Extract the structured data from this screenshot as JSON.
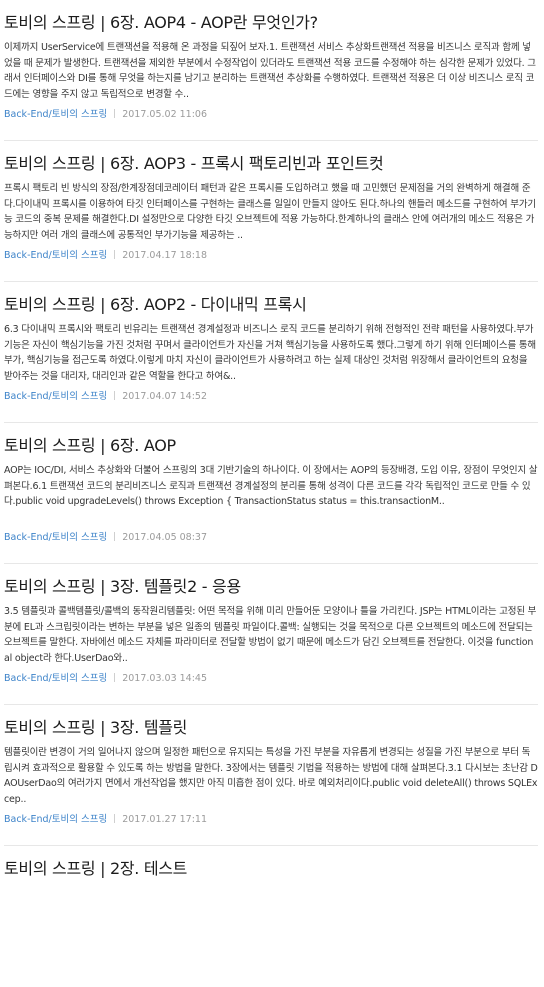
{
  "posts": [
    {
      "title": "토비의 스프링 | 6장. AOP4 - AOP란 무엇인가?",
      "summary": "이제까지 UserService에 트랜잭션을 적용해 온 과정을 되짚어 보자.1. 트랜잭션 서비스 추상화트랜잭션 적용을 비즈니스 로직과 함께 넣었을 때 문제가 발생한다. 트랜잭션을 제외한 부분에서 수정작업이 있더라도 트랜잭션 적용 코드를 수정해야 하는 심각한 문제가 있었다. 그래서 인터페이스와 DI를 통해 무엇을 하는지를 남기고 분리하는 트랜잭션 추상화를 수행하였다. 트랜잭션 적용은 더 이상 비즈니스 로직 코드에는 영향을 주지 않고 독립적으로 변경할 수..",
      "category": "Back-End/토비의 스프링",
      "date": "2017.05.02 11:06"
    },
    {
      "title": "토비의 스프링 | 6장. AOP3 - 프록시 팩토리빈과 포인트컷",
      "summary": "프록시 팩토리 빈 방식의 장점/한계장점데코레이터 패턴과 같은 프록시를 도입하려고 했을 때 고민했던 문제점을 거의 완벽하게 해결해 준다.다이내믹 프록시를 이용하여 타깃 인터페이스를 구현하는 클래스를 일일이 만들지 않아도 된다.하나의 핸들러 메소드를 구현하여 부가기능 코드의 중복 문제를 해결한다.DI 설정만으로 다양한 타깃 오브젝트에 적용 가능하다.한계하나의 클래스 안에 여러개의 메소드 적용은 가능하지만 여러 개의 클래스에 공통적인 부가기능을 제공하는 ..",
      "category": "Back-End/토비의 스프링",
      "date": "2017.04.17 18:18"
    },
    {
      "title": "토비의 스프링 | 6장. AOP2 - 다이내믹 프록시",
      "summary": "6.3 다이내믹 프록시와 팩토리 빈유리는 트랜잭션 경계설정과 비즈니스 로직 코드를 분리하기 위해 전형적인 전략 패턴을 사용하였다.부가기능은 자신이 핵심기능을 가진 것처럼 꾸며서 클라이언트가 자신을 거쳐 핵심기능을 사용하도록 했다.그렇게 하기 위해 인터페이스를 통해 부가, 핵심기능을 접근도록 하였다.이렇게 마치 자신이 클라이언트가 사용하려고 하는 실제 대상인 것처럼 위장해서 클라이언트의 요청을 받아주는 것을 대리자, 대리인과 같은 역할을 한다고 하여&..",
      "category": "Back-End/토비의 스프링",
      "date": "2017.04.07 14:52"
    },
    {
      "title": "토비의 스프링 | 6장. AOP",
      "summary": "AOP는 IOC/DI, 서비스 추상화와 더불어 스프링의 3대 기반기술의 하나이다. 이 장에서는 AOP의 등장배경, 도입 이유, 장점이 무엇인지 살펴본다.6.1 트랜잭션 코드의 분리비즈니스 로직과 트랜잭션 경계설정의 분리를 통해 성격이 다른 코드를 각각 독립적인 코드로 만들 수 있다.public void upgradeLevels() throws Exception { TransactionStatus status = this.transactionM..",
      "category": "Back-End/토비의 스프링",
      "date": "2017.04.05 08:37"
    },
    {
      "title": "토비의 스프링 | 3장. 템플릿2 - 응용",
      "summary": "3.5 템플릿과 콜백템플릿/콜백의 동작원리템플릿: 어떤 목적을 위해 미리 만들어둔 모양이나 틀을 가리킨다. JSP는 HTML이라는 고정된 부분에 EL과 스크립릿이라는 변하는 부분을 넣은 일종의 템플릿 파일이다.콜백: 실행되는 것을 목적으로 다른 오브젝트의 메소드에 전달되는 오브젝트를 말한다. 자바에선 메소드 자체를 파라미터로 전달할 방법이 없기 때문에 메소드가 담긴 오브젝트를 전달한다. 이것을 functional object라 한다.UserDao와..",
      "category": "Back-End/토비의 스프링",
      "date": "2017.03.03 14:45"
    },
    {
      "title": "토비의 스프링 | 3장. 템플릿",
      "summary": "템플릿이란 변경이 거의 일어나지 않으며 일정한 패턴으로 유지되는 특성을 가진 부분을 자유롭게 변경되는 성질을 가진 부분으로 부터 독립시켜 효과적으로 활용할 수 있도록 하는 방법을 말한다. 3장에서는 템플릿 기법을 적용하는 방법에 대해 살펴본다.3.1 다시보는 초난감 DAOUserDao의 여러가지 면에서 개선작업을 했지만 아직 미흡한 점이 있다. 바로 예외처리이다.public void deleteAll() throws SQLExcep..",
      "category": "Back-End/토비의 스프링",
      "date": "2017.01.27 17:11"
    },
    {
      "title": "토비의 스프링 | 2장. 테스트",
      "summary": "",
      "category": "",
      "date": ""
    }
  ]
}
